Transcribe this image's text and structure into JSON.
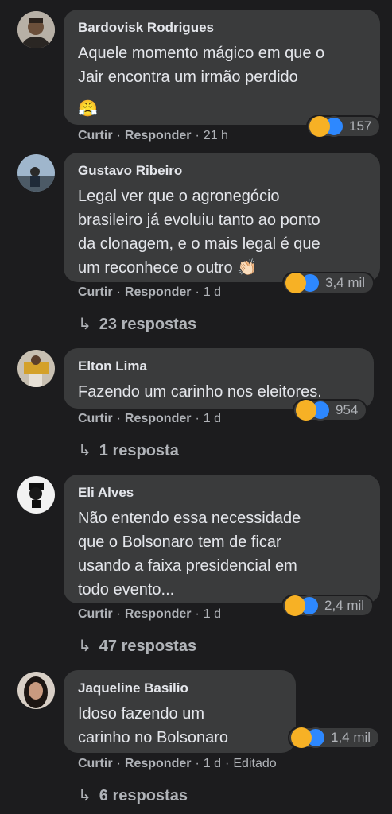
{
  "labels": {
    "like": "Curtir",
    "reply": "Responder",
    "dot": "·"
  },
  "colors": {
    "background": "#1c1c1e",
    "bubble": "#3a3b3c",
    "haha": "#f7b125",
    "like": "#2d88ff"
  },
  "comments": [
    {
      "name": "Bardovisk Rodrigues",
      "lines": [
        "Aquele momento mágico em que o",
        "Jair encontra um irmão perdido"
      ],
      "emoji": "😤",
      "time": "21 h",
      "reaction_count": "157",
      "replies": ""
    },
    {
      "name": "Gustavo Ribeiro",
      "lines": [
        "Legal ver que o agronegócio",
        "brasileiro já evoluiu tanto ao ponto",
        "da clonagem, e o mais legal é que",
        "um reconhece o outro 👏🏻"
      ],
      "time": "1 d",
      "reaction_count": "3,4 mil",
      "replies": "23 respostas"
    },
    {
      "name": "Elton Lima",
      "lines": [
        "Fazendo um carinho nos eleitores."
      ],
      "time": "1 d",
      "reaction_count": "954",
      "replies": "1 resposta"
    },
    {
      "name": "Eli Alves",
      "lines": [
        "Não entendo essa necessidade",
        "que o Bolsonaro tem de ficar",
        "usando a faixa presidencial em",
        "todo evento..."
      ],
      "time": "1 d",
      "reaction_count": "2,4 mil",
      "replies": "47 respostas"
    },
    {
      "name": "Jaqueline Basilio",
      "lines": [
        "Idoso fazendo um",
        "carinho no Bolsonaro"
      ],
      "time": "1 d",
      "edited": "Editado",
      "reaction_count": "1,4 mil",
      "replies": "6 respostas"
    }
  ]
}
